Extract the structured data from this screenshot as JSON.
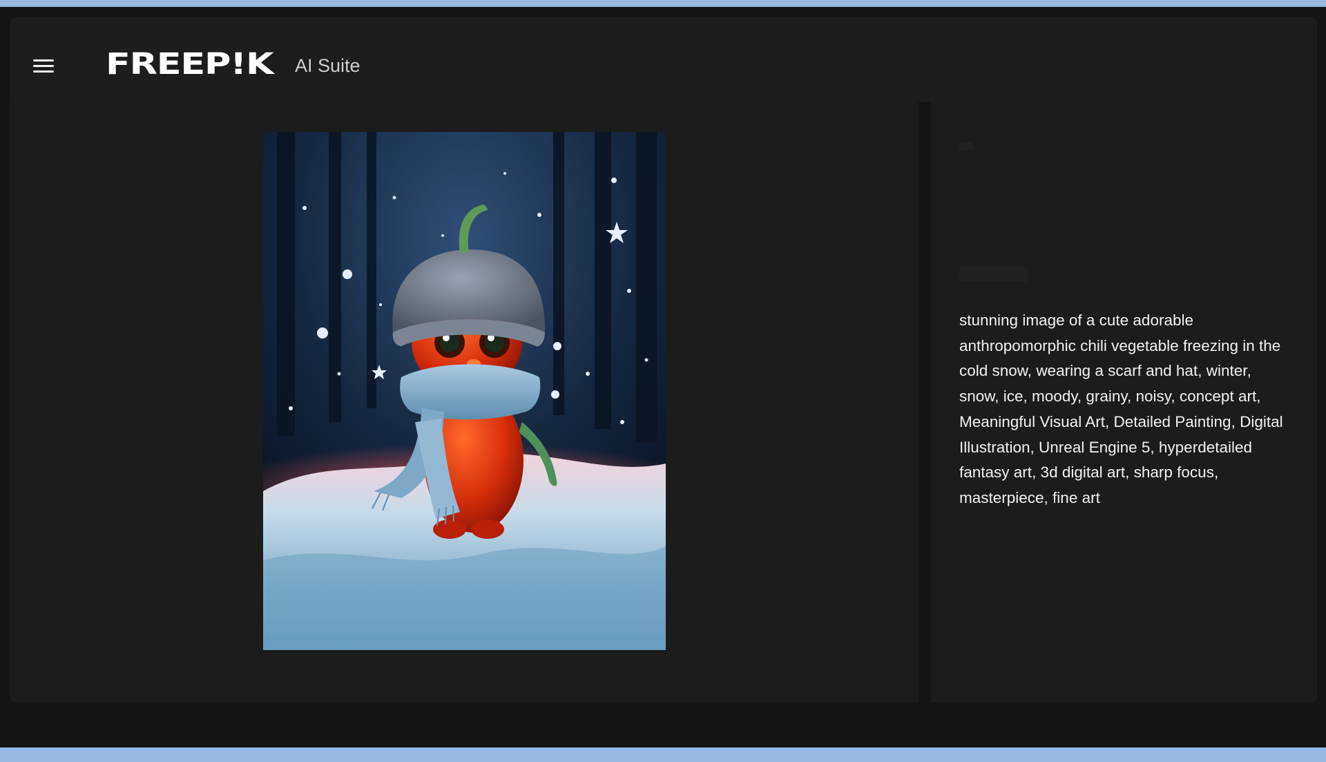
{
  "header": {
    "logo_text": "FREEP!K",
    "suite_label": "AI Suite",
    "menu_icon": "hamburger-menu-icon"
  },
  "canvas": {
    "image_subject": "cute anthropomorphic chili pepper in knit hat and scarf standing in snow"
  },
  "panel": {
    "prompt": "stunning image of a cute adorable anthropomorphic chili vegetable freezing in the cold snow, wearing a scarf and hat, winter, snow, ice, moody, grainy, noisy, concept art, Meaningful Visual Art, Detailed Painting, Digital Illustration, Unreal Engine 5, hyperdetailed fantasy art, 3d digital art, sharp focus, masterpiece, fine art"
  },
  "colors": {
    "app_background": "#1c1c1c",
    "screen_frame": "#98b8e2",
    "text_primary": "#f2f2f2",
    "text_secondary": "#cfcfcf"
  }
}
